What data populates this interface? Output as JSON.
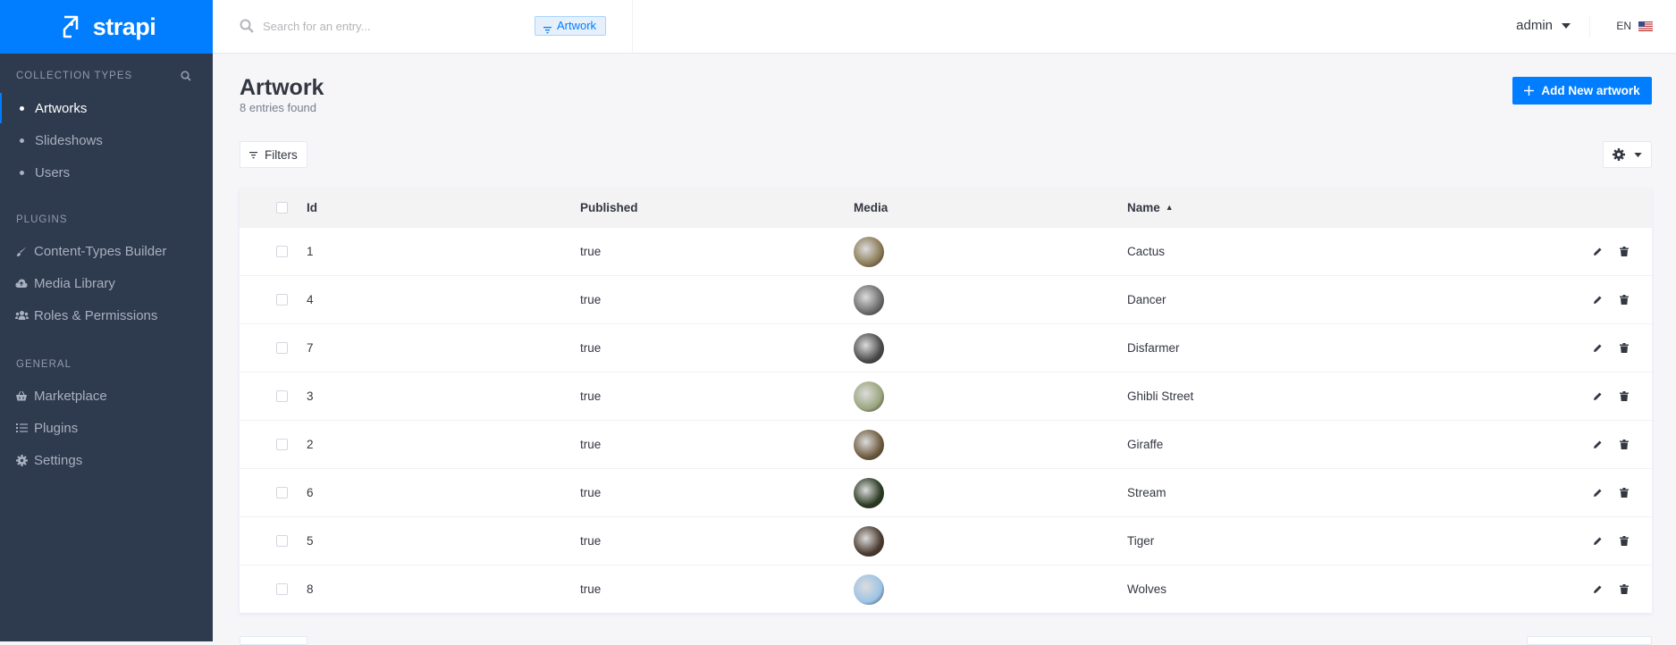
{
  "brand": {
    "name": "strapi",
    "color": "#007eff"
  },
  "sidebar": {
    "collection_types_title": "COLLECTION TYPES",
    "collection_items": [
      {
        "label": "Artworks",
        "active": true
      },
      {
        "label": "Slideshows",
        "active": false
      },
      {
        "label": "Users",
        "active": false
      }
    ],
    "plugins_title": "PLUGINS",
    "plugin_items": [
      {
        "label": "Content-Types Builder",
        "icon": "paintbrush-icon"
      },
      {
        "label": "Media Library",
        "icon": "cloud-upload-icon"
      },
      {
        "label": "Roles & Permissions",
        "icon": "users-icon"
      }
    ],
    "general_title": "GENERAL",
    "general_items": [
      {
        "label": "Marketplace",
        "icon": "shopping-basket-icon"
      },
      {
        "label": "Plugins",
        "icon": "list-icon"
      },
      {
        "label": "Settings",
        "icon": "gear-icon"
      }
    ]
  },
  "header": {
    "search_placeholder": "Search for an entry...",
    "filter_tag": "Artwork",
    "user": "admin",
    "language": "EN"
  },
  "page": {
    "title": "Artwork",
    "subtitle": "8 entries found",
    "add_button": "Add New artwork",
    "filters_button": "Filters"
  },
  "table": {
    "columns": [
      "Id",
      "Published",
      "Media",
      "Name"
    ],
    "sorted_column": "Name",
    "rows": [
      {
        "id": "1",
        "published": "true",
        "name": "Cactus",
        "media_color": "#8a7a55"
      },
      {
        "id": "4",
        "published": "true",
        "name": "Dancer",
        "media_color": "#6b6b6b"
      },
      {
        "id": "7",
        "published": "true",
        "name": "Disfarmer",
        "media_color": "#4a4a4a"
      },
      {
        "id": "3",
        "published": "true",
        "name": "Ghibli Street",
        "media_color": "#9aa57d"
      },
      {
        "id": "2",
        "published": "true",
        "name": "Giraffe",
        "media_color": "#6e5a3e"
      },
      {
        "id": "6",
        "published": "true",
        "name": "Stream",
        "media_color": "#2a3a22"
      },
      {
        "id": "5",
        "published": "true",
        "name": "Tiger",
        "media_color": "#4a3b30"
      },
      {
        "id": "8",
        "published": "true",
        "name": "Wolves",
        "media_color": "#9cc3e6"
      }
    ]
  }
}
